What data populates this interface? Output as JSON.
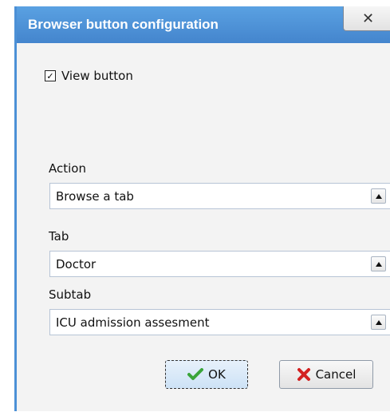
{
  "window": {
    "title": "Browser button configuration",
    "close_symbol": "✕"
  },
  "checkbox": {
    "label": "View button",
    "checked": true,
    "check_mark": "✓"
  },
  "fields": [
    {
      "label": "Action",
      "value": "Browse a tab"
    },
    {
      "label": "Tab",
      "value": "Doctor"
    },
    {
      "label": "Subtab",
      "value": "ICU admission assesment"
    }
  ],
  "buttons": {
    "ok_label": "OK",
    "ok_icon": "checkmark-icon",
    "cancel_label": "Cancel",
    "cancel_icon": "red-x-icon"
  },
  "colors": {
    "titlebar": "#4c90d6",
    "ok_check": "#3aa53a",
    "cancel_x": "#d32020"
  }
}
